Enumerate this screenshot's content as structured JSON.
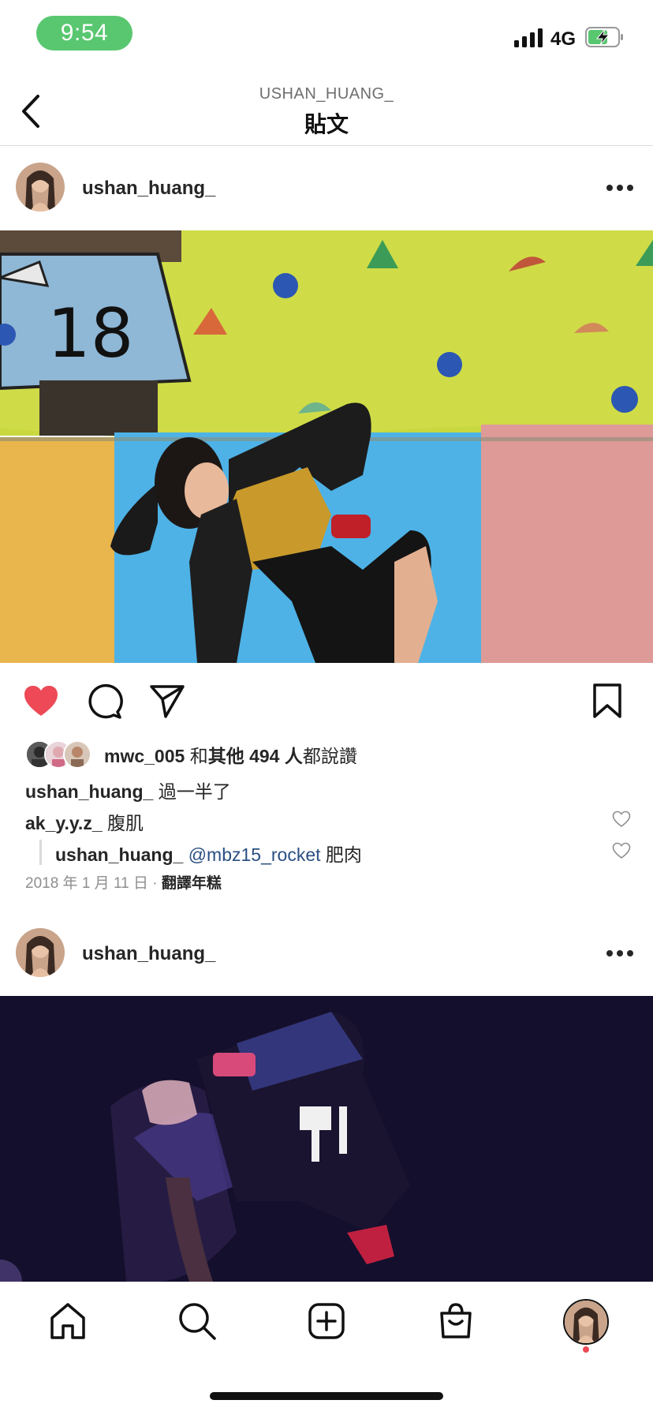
{
  "status_bar": {
    "time": "9:54",
    "network": "4G"
  },
  "header": {
    "subtitle": "USHAN_HUANG_",
    "title": "貼文"
  },
  "posts": [
    {
      "username": "ushan_huang_",
      "photo_number": "18",
      "liked_by": {
        "user": "mwc_005",
        "middle": " 和",
        "others": "其他 494 人",
        "suffix": "都說讚"
      },
      "caption": {
        "user": "ushan_huang_",
        "text": " 過一半了"
      },
      "comments": [
        {
          "user": "ak_y.y.z_",
          "text": " 腹肌"
        },
        {
          "user": "ushan_huang_",
          "mention": " @mbz15_rocket",
          "text": " 肥肉"
        }
      ],
      "date": "2018 年 1 月 11 日",
      "separator": " · ",
      "translate": "翻譯年糕"
    },
    {
      "username": "ushan_huang_"
    }
  ],
  "icons": {
    "back": "chevron-left-icon",
    "more": "more-horizontal-icon",
    "like": "heart-filled-icon",
    "comment": "comment-icon",
    "share": "paper-plane-icon",
    "save": "bookmark-icon",
    "home": "home-icon",
    "search": "search-icon",
    "create": "plus-square-icon",
    "shop": "shopping-bag-icon",
    "profile": "profile-avatar"
  },
  "colors": {
    "status_pill": "#59c770",
    "like": "#ed4956",
    "mention": "#2a4f82",
    "text": "#262626",
    "muted": "#8e8e8e"
  }
}
